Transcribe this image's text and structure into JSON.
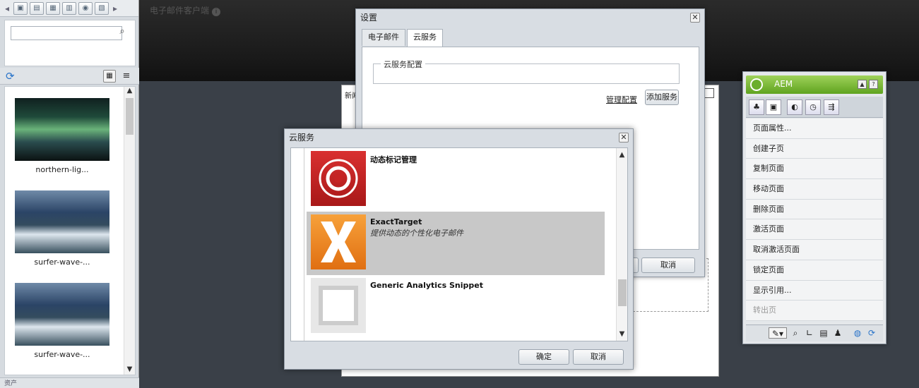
{
  "topbar": {
    "title": "电子邮件客户端"
  },
  "left_panel": {
    "toolbar_icons": [
      "back-arrow-icon",
      "image-icon",
      "document-icon",
      "page-icon",
      "calendar-icon",
      "flash-icon",
      "table-icon",
      "forward-arrow-icon"
    ],
    "search": {
      "value": "",
      "placeholder": ""
    },
    "assets": [
      {
        "caption": "northern-lig...",
        "image": "aurora"
      },
      {
        "caption": "surfer-wave-...",
        "image": "wave"
      },
      {
        "caption": "surfer-wave-...",
        "image": "wave"
      }
    ],
    "bottom_label": "资产"
  },
  "page": {
    "new_label": "新闻"
  },
  "settings_dialog": {
    "title": "设置",
    "tabs": [
      "电子邮件",
      "云服务"
    ],
    "active_tab": "云服务",
    "fieldset_legend": "云服务配置",
    "manage_link": "管理配置",
    "add_button": "添加服务",
    "cancel": "取消"
  },
  "cloud_dialog": {
    "title": "云服务",
    "services": [
      {
        "name": "动态标记管理",
        "desc": "",
        "logo": "dtm"
      },
      {
        "name": "ExactTarget",
        "desc": "提供动态的个性化电子邮件",
        "logo": "exacttarget",
        "selected": true
      },
      {
        "name": "Generic Analytics Snippet",
        "desc": "",
        "logo": "generic"
      }
    ],
    "ok": "确定",
    "cancel": "取消"
  },
  "aem_sidekick": {
    "title": "AEM",
    "menu": [
      "页面属性...",
      "创建子页",
      "复制页面",
      "移动页面",
      "删除页面",
      "激活页面",
      "取消激活页面",
      "锁定页面",
      "显示引用...",
      "转出页"
    ],
    "disabled": [
      "转出页"
    ]
  },
  "colors": {
    "aem_green": "#6cae2c",
    "selected_row": "#c8c8c8",
    "dtm_red": "#c62424",
    "et_orange": "#ee8420"
  }
}
